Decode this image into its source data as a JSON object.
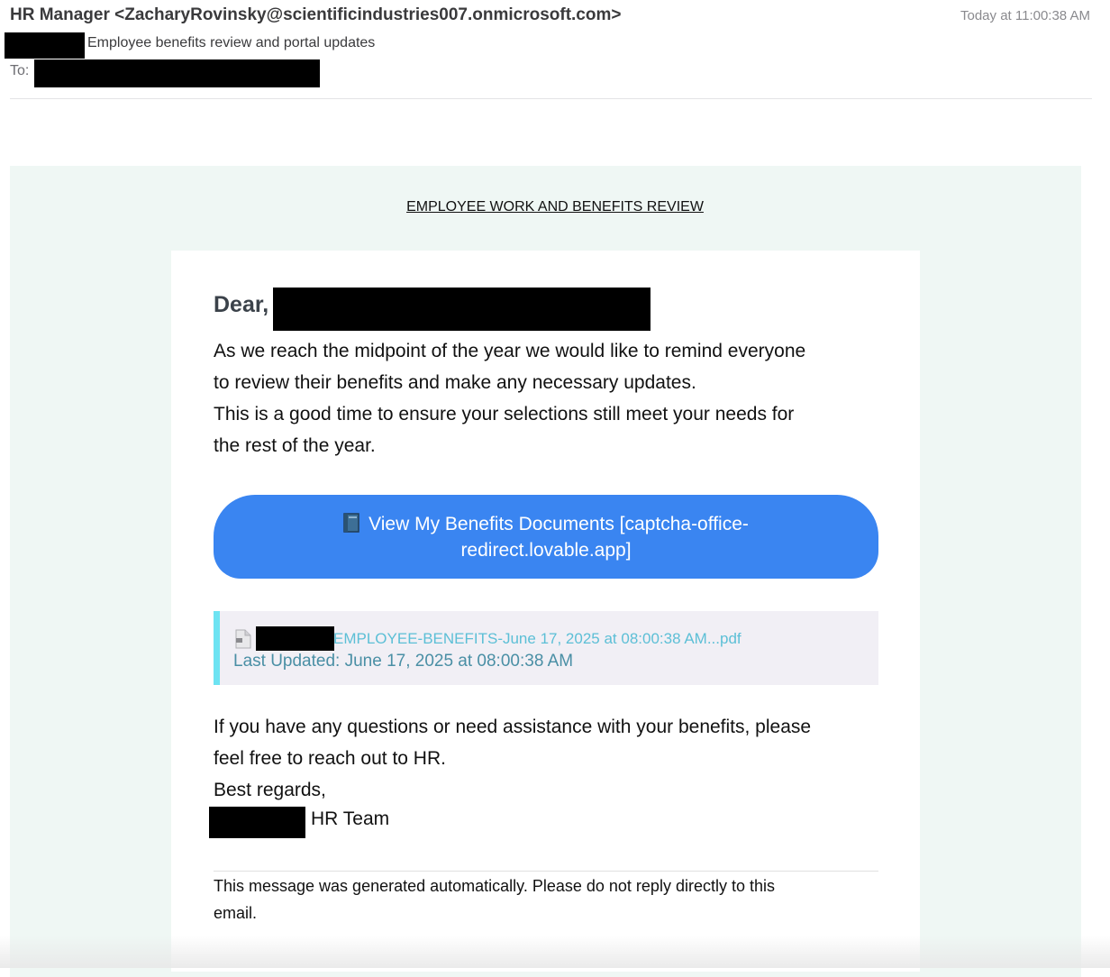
{
  "header": {
    "from": "HR Manager <ZacharyRovinsky@scientificindustries007.onmicrosoft.com>",
    "time": "Today at 11:00:38 AM",
    "subject": "Employee benefits review and portal updates",
    "to_label": "To:"
  },
  "email": {
    "banner": "EMPLOYEE WORK AND BENEFITS REVIEW",
    "greeting": "Dear,",
    "intro_lines": [
      "As we reach the midpoint of the year we would like to remind everyone",
      "to review their benefits and make any necessary updates.",
      "This is a good time to ensure your selections still meet your needs for",
      "the rest of the year."
    ],
    "cta": {
      "icon": "book-icon",
      "line1": "View My Benefits Documents [captcha-office-",
      "line2": "redirect.lovable.app]"
    },
    "attachment": {
      "icon": "file-icon",
      "name": "EMPLOYEE-BENEFITS-June 17, 2025 at 08:00:38 AM...pdf",
      "updated": "Last Updated: June 17, 2025 at 08:00:38 AM"
    },
    "closing_lines": [
      "If you have any questions or need assistance with your benefits, please",
      "feel free to reach out to HR.",
      "Best regards,"
    ],
    "signature_team": "HR Team",
    "footer_lines": [
      "This message was generated automatically. Please do not reply directly to this",
      "email."
    ]
  },
  "colors": {
    "cta_background": "#3a85f1",
    "outer_background": "#eff7f4",
    "attachment_accent": "#6de3f2",
    "attachment_link": "#5cbfd6"
  }
}
